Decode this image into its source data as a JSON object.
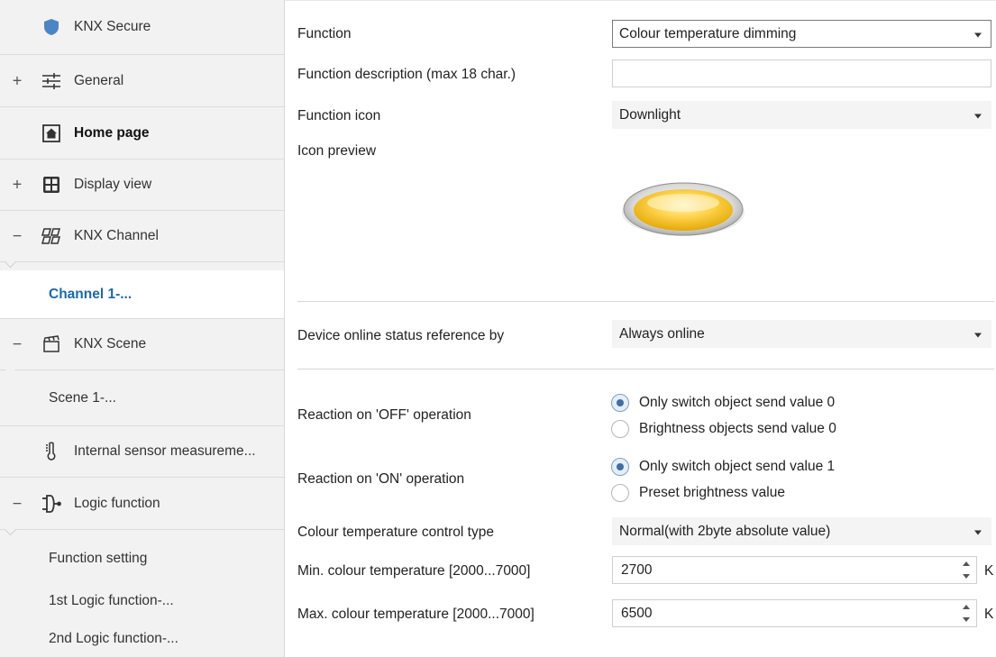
{
  "sidebar": {
    "knx_secure": "KNX Secure",
    "general": "General",
    "home_page": "Home page",
    "display_view": "Display view",
    "knx_channel": "KNX Channel",
    "channel_1": "Channel 1-...",
    "knx_scene": "KNX Scene",
    "scene_1": "Scene 1-...",
    "internal_sensor": "Internal sensor measureme...",
    "logic_function": "Logic function",
    "function_setting": "Function setting",
    "logic_1": "1st Logic function-...",
    "logic_2": "2nd Logic function-...",
    "expand_plus": "+",
    "collapse_minus": "−"
  },
  "main": {
    "function_label": "Function",
    "function_value": "Colour temperature dimming",
    "function_desc_label": "Function description (max 18 char.)",
    "function_desc_value": "",
    "function_icon_label": "Function icon",
    "function_icon_value": "Downlight",
    "icon_preview_label": "Icon preview",
    "online_status_label": "Device online status reference by",
    "online_status_value": "Always online",
    "off_label": "Reaction on 'OFF' operation",
    "off_options": [
      "Only switch object send value 0",
      "Brightness objects send value 0"
    ],
    "off_selected": 0,
    "on_label": "Reaction on 'ON' operation",
    "on_options": [
      "Only switch object send value 1",
      "Preset brightness value"
    ],
    "on_selected": 0,
    "ct_type_label": "Colour temperature control type",
    "ct_type_value": "Normal(with 2byte absolute value)",
    "min_ct_label": "Min. colour temperature [2000...7000]",
    "min_ct_value": "2700",
    "max_ct_label": "Max. colour temperature [2000...7000]",
    "max_ct_value": "6500",
    "unit": "K"
  },
  "colors": {
    "active_link": "#1c6aa8",
    "sidebar_bg": "#f2f2f2",
    "shield_icon": "#4a86c5",
    "radio_dot": "#3d6fa3"
  }
}
